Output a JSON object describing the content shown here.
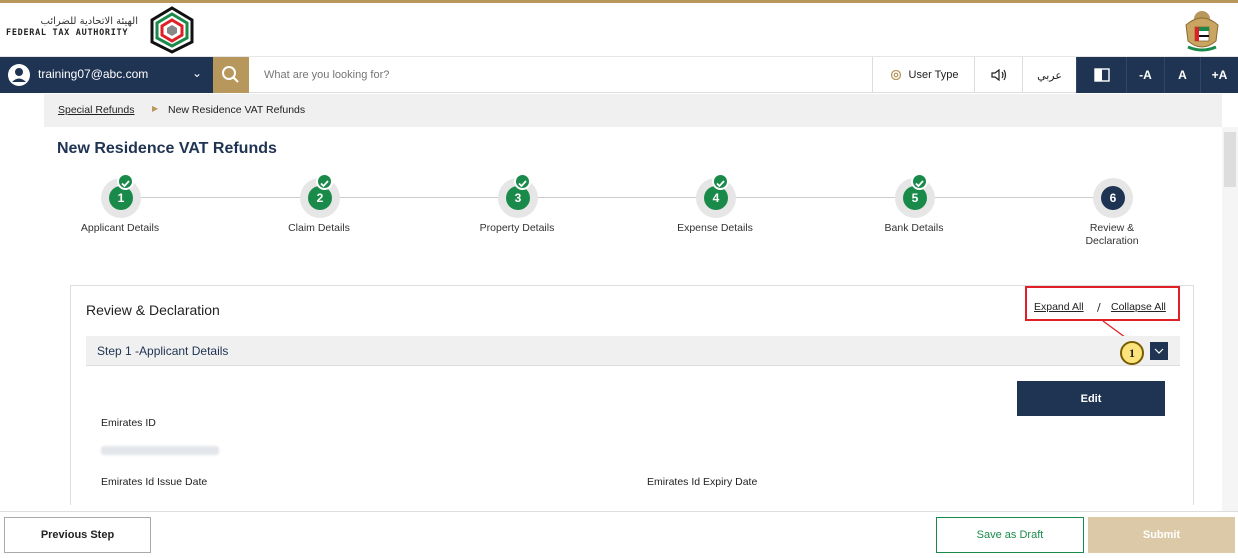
{
  "header": {
    "logo_arabic": "الهيئة الاتحادية للضرائب",
    "logo_english": "FEDERAL TAX AUTHORITY"
  },
  "navbar": {
    "user_email": "training07@abc.com",
    "search_placeholder": "What are you looking for?",
    "user_type_label": "User Type",
    "arabic_label": "عربي",
    "font_decrease": "-A",
    "font_normal": "A",
    "font_increase": "+A"
  },
  "breadcrumb": {
    "parent": "Special Refunds",
    "current": "New Residence VAT Refunds"
  },
  "page_title": "New Residence VAT Refunds",
  "stepper": [
    {
      "number": "1",
      "label": "Applicant Details",
      "completed": true
    },
    {
      "number": "2",
      "label": "Claim Details",
      "completed": true
    },
    {
      "number": "3",
      "label": "Property Details",
      "completed": true
    },
    {
      "number": "4",
      "label": "Expense Details",
      "completed": true
    },
    {
      "number": "5",
      "label": "Bank Details",
      "completed": true
    },
    {
      "number": "6",
      "label": "Review & Declaration",
      "completed": false
    }
  ],
  "review": {
    "title": "Review & Declaration",
    "expand_all": "Expand All",
    "separator": "/",
    "collapse_all": "Collapse All",
    "callout_number": "1",
    "section_header": "Step 1 -Applicant Details",
    "edit_label": "Edit",
    "emirates_id_label": "Emirates ID",
    "issue_date_label": "Emirates Id Issue Date",
    "expiry_date_label": "Emirates Id Expiry Date"
  },
  "footer": {
    "previous_label": "Previous Step",
    "draft_label": "Save as Draft",
    "submit_label": "Submit"
  },
  "colors": {
    "navy": "#1f3352",
    "gold": "#b8975c",
    "green": "#1a8a4a",
    "annotation_red": "#e01f26"
  }
}
